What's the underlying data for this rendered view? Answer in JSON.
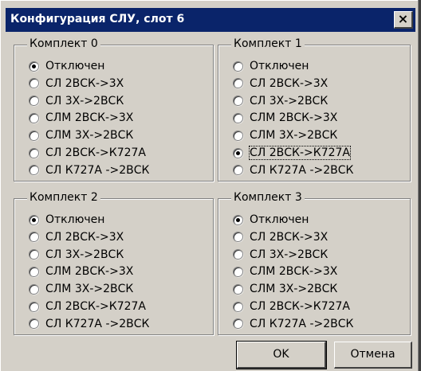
{
  "window": {
    "title": "Конфигурация СЛУ, слот 6",
    "close_label": "×"
  },
  "options_list": [
    "Отключен",
    "СЛ 2ВСК->3Х",
    "СЛ 3Х->2ВСК",
    "СЛМ 2ВСК->3Х",
    "СЛМ 3Х->2ВСК",
    "СЛ 2ВСК->К727А",
    "СЛ К727А ->2ВСК"
  ],
  "groups": [
    {
      "title": "Комплект 0",
      "selected_index": 0
    },
    {
      "title": "Комплект 1",
      "selected_index": 5
    },
    {
      "title": "Комплект 2",
      "selected_index": 0
    },
    {
      "title": "Комплект 3",
      "selected_index": 0
    }
  ],
  "buttons": {
    "ok_label": "OK",
    "cancel_label": "Отмена"
  }
}
